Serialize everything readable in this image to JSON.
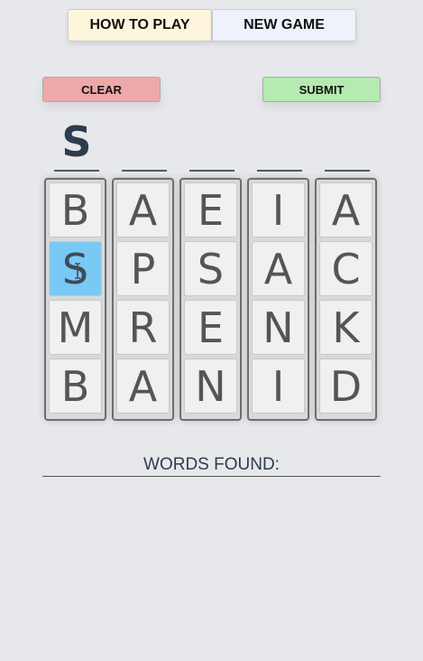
{
  "header": {
    "how_to_play": "HOW TO PLAY",
    "new_game": "NEW GAME"
  },
  "actions": {
    "clear": "CLEAR",
    "submit": "SUBMIT"
  },
  "current_word": [
    "S",
    "",
    "",
    "",
    ""
  ],
  "grid": [
    [
      "B",
      "S",
      "M",
      "B"
    ],
    [
      "A",
      "P",
      "R",
      "A"
    ],
    [
      "E",
      "S",
      "E",
      "N"
    ],
    [
      "I",
      "A",
      "N",
      "I"
    ],
    [
      "A",
      "C",
      "K",
      "D"
    ]
  ],
  "selected_tile": {
    "column": 1,
    "row": 2
  },
  "colors": {
    "selected": "#79c9f5",
    "clear": "#eda8aa",
    "submit": "#b5eab0"
  },
  "words_found": {
    "label": "WORDS FOUND:",
    "items": []
  }
}
